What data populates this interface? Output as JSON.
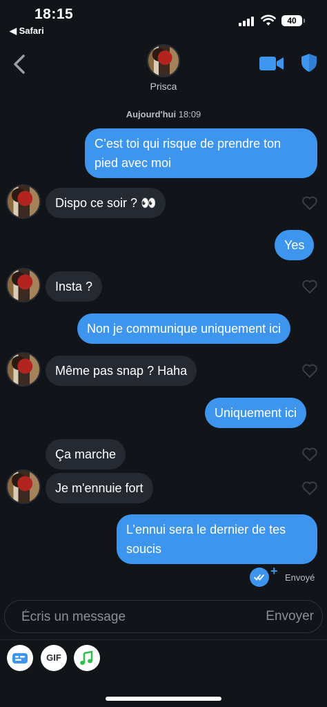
{
  "status_bar": {
    "time": "18:15",
    "back_app": "◀ Safari",
    "battery": "40"
  },
  "header": {
    "contact_name": "Prisca"
  },
  "conversation": {
    "date_label_day": "Aujourd'hui",
    "date_label_time": "18:09",
    "messages": [
      {
        "direction": "out",
        "text": "C’est toi qui risque de prendre ton pied avec moi"
      },
      {
        "direction": "in",
        "text": "Dispo ce soir ? 👀"
      },
      {
        "direction": "out",
        "text": "Yes"
      },
      {
        "direction": "in",
        "text": "Insta ?"
      },
      {
        "direction": "out",
        "text": "Non je communique uniquement ici"
      },
      {
        "direction": "in",
        "text": "Même pas snap ? Haha"
      },
      {
        "direction": "out",
        "text": "Uniquement ici"
      },
      {
        "direction": "in",
        "text": "Ça marche"
      },
      {
        "direction": "in",
        "text": "Je m'ennuie fort"
      },
      {
        "direction": "out",
        "text": "L’ennui sera le dernier de tes soucis"
      }
    ],
    "sent_status": "Envoyé"
  },
  "composer": {
    "placeholder": "Écris un message",
    "send_label": "Envoyer"
  },
  "toolbar": {
    "gif_label": "GIF"
  },
  "colors": {
    "accent": "#3d95ee",
    "background": "#111418",
    "incoming_bubble": "#252931"
  }
}
